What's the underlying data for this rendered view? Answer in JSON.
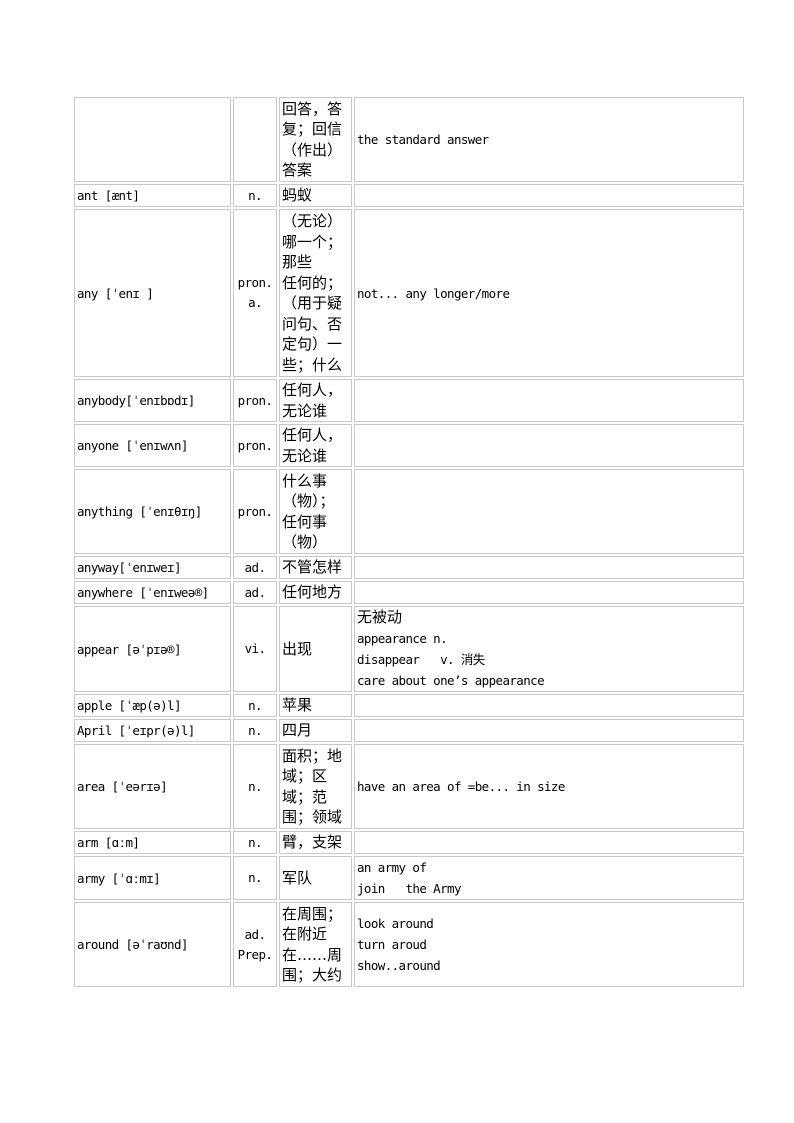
{
  "table": {
    "rows": [
      {
        "word": "",
        "pos": [],
        "definition": [
          "回答，答复；回信（作出）答案"
        ],
        "examples": [
          "the standard answer"
        ],
        "size": "h-4"
      },
      {
        "word": "ant  [ænt]",
        "pos": [
          "n."
        ],
        "definition": [
          "蚂蚁"
        ],
        "examples": [],
        "size": "h-1"
      },
      {
        "word": "any [ˈenɪ ]",
        "pos": [
          "pron.",
          "a."
        ],
        "definition": [
          "（无论）哪一个；那些",
          "任何的；（用于疑问句、否定句）一些；什么"
        ],
        "examples": [
          "not... any longer/more"
        ],
        "size": "h-8"
      },
      {
        "word": "anybody[ˈenɪbɒdɪ]",
        "pos": [
          "pron."
        ],
        "definition": [
          "任何人，无论谁"
        ],
        "examples": [],
        "size": "h-2"
      },
      {
        "word": "anyone [ˈenɪwʌn]",
        "pos": [
          "pron."
        ],
        "definition": [
          "任何人，无论谁"
        ],
        "examples": [],
        "size": "h-2"
      },
      {
        "word": "anything [ˈenɪθɪŋ]",
        "pos": [
          "pron."
        ],
        "definition": [
          "什么事（物）；任何事（物）"
        ],
        "examples": [],
        "size": "h-4"
      },
      {
        "word": "anyway[ˈenɪweɪ]",
        "pos": [
          "ad."
        ],
        "definition": [
          "不管怎样"
        ],
        "examples": [],
        "size": "h-1"
      },
      {
        "word": "anywhere [ˈenɪweə®]",
        "pos": [
          "ad."
        ],
        "definition": [
          "任何地方"
        ],
        "examples": [],
        "size": "h-1"
      },
      {
        "word": "appear  [əˈpɪə®]",
        "pos": [
          "vi."
        ],
        "definition": [
          "出现"
        ],
        "examples": [
          "无被动",
          "appearance n.",
          "disappear   v. 消失",
          "care about one’s appearance"
        ],
        "examples_cjk_lines": [
          0
        ],
        "size": "h-4"
      },
      {
        "word": "apple [ˈæp(ə)l]",
        "pos": [
          "n."
        ],
        "definition": [
          "苹果"
        ],
        "examples": [],
        "size": "h-1"
      },
      {
        "word": "April [ˈeɪpr(ə)l]",
        "pos": [
          "n."
        ],
        "definition": [
          "四月"
        ],
        "examples": [],
        "size": "h-1"
      },
      {
        "word": "area   [ˈeərɪə]",
        "pos": [
          "n."
        ],
        "definition": [
          "面积；地域；区域；范围；领域"
        ],
        "examples": [
          "have an area of =be... in size"
        ],
        "size": "h-4"
      },
      {
        "word": "arm [ɑːm]",
        "pos": [
          "n."
        ],
        "definition": [
          "臂，支架"
        ],
        "examples": [],
        "size": "h-1"
      },
      {
        "word": "army [ˈɑːmɪ]",
        "pos": [
          "n."
        ],
        "definition": [
          "军队"
        ],
        "examples": [
          "an army of",
          "join   the Army"
        ],
        "size": "h-2"
      },
      {
        "word": "around [əˈraʊnd]",
        "pos": [
          "ad.",
          "Prep."
        ],
        "definition": [
          "在周围；在附近",
          "在……周围；大约"
        ],
        "examples": [
          "look around",
          "turn aroud",
          "show..around"
        ],
        "size": "h-4"
      }
    ]
  }
}
